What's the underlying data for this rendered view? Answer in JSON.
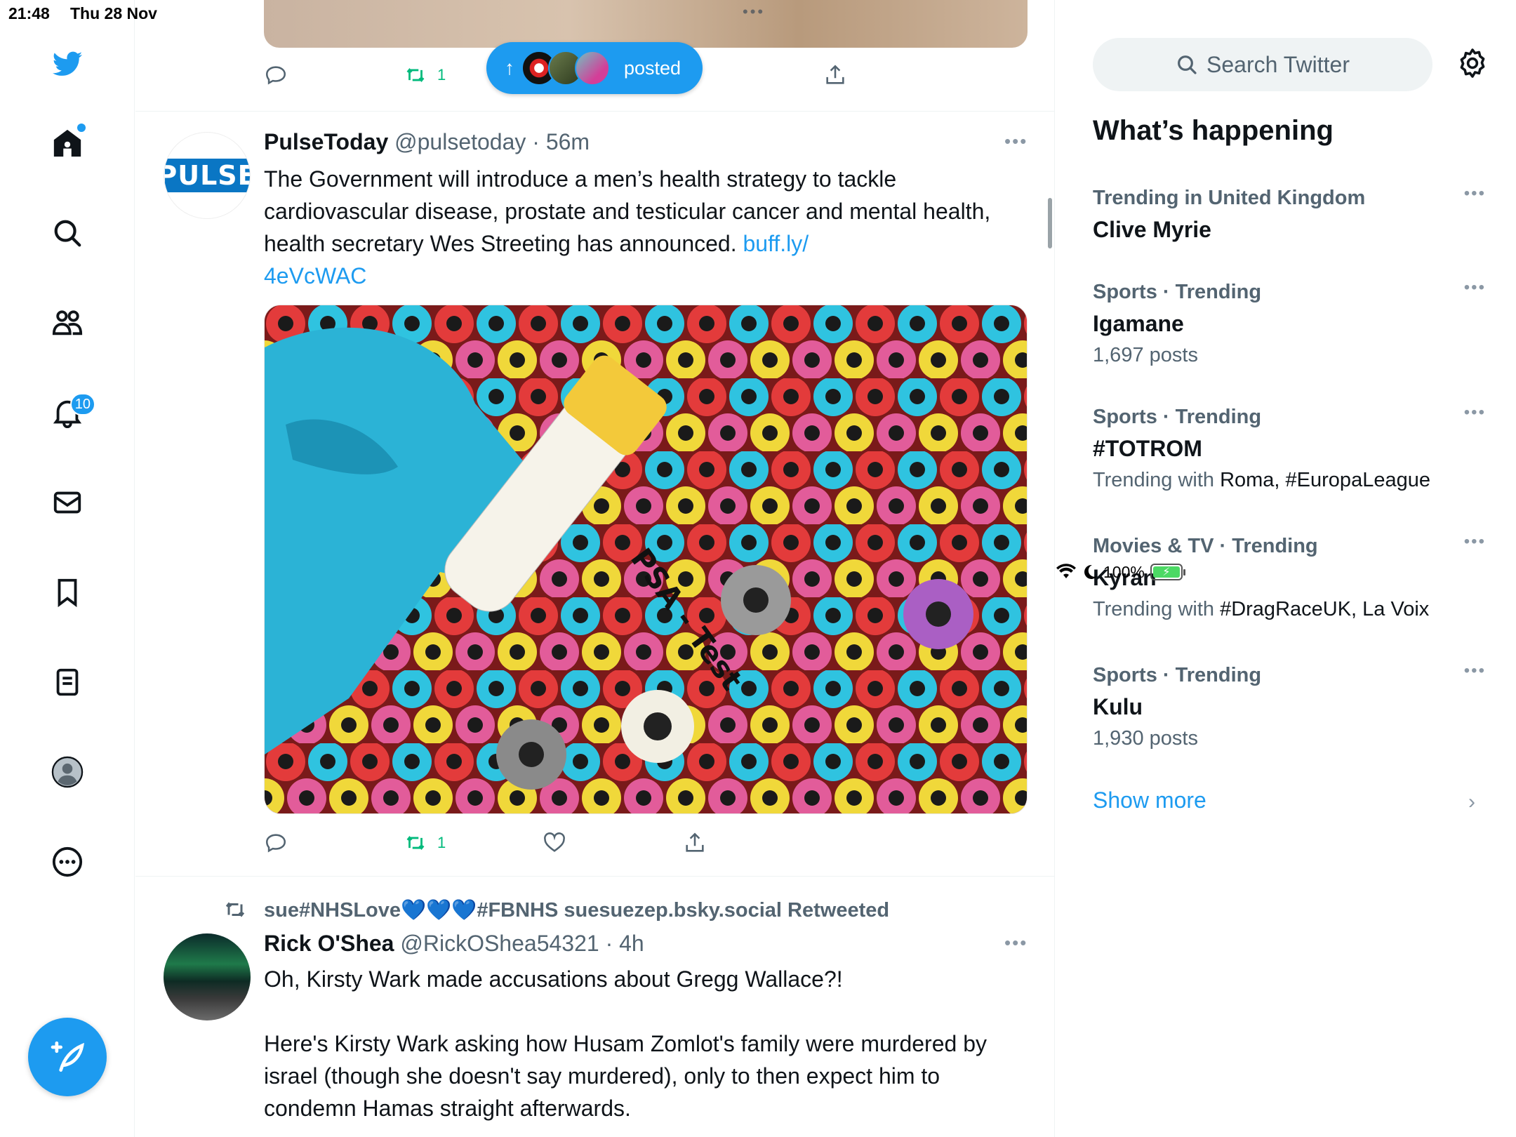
{
  "status_bar": {
    "time": "21:48",
    "date": "Thu 28 Nov",
    "battery": "100%"
  },
  "sidebar": {
    "notifications_badge": "10"
  },
  "feed": {
    "prev_tweet": {
      "retweet_count": "1"
    },
    "new_posts_pill": {
      "label": "posted"
    },
    "tweet1": {
      "name": "PulseToday",
      "handle": "@pulsetoday",
      "time": "56m",
      "avatar_text": "PULSE",
      "text": "The Government will introduce a men’s health strategy to tackle cardiovascular disease, prostate and testicular cancer and mental health, health secretary Wes Streeting has announced. ",
      "link": "buff.ly/\n4eVcWAC",
      "image_label": "PSA - Test",
      "retweet_count": "1"
    },
    "tweet2": {
      "retweeted_by": "sue#NHSLove💙💙💙#FBNHS suesuezep.bsky.social Retweeted",
      "name": "Rick O'Shea",
      "handle": "@RickOShea54321",
      "time": "4h",
      "text_line1": "Oh, Kirsty Wark made accusations about Gregg Wallace?!",
      "text_para2": "Here's Kirsty Wark asking how Husam Zomlot's family were murdered by israel (though she doesn't say murdered), only to then expect him to condemn Hamas straight afterwards."
    }
  },
  "right": {
    "search_placeholder": "Search Twitter",
    "section_title": "What’s happening",
    "trends": [
      {
        "context": "Trending in United Kingdom",
        "title": "Clive Myrie",
        "sub_prefix": "",
        "sub_value": ""
      },
      {
        "context": "Sports · Trending",
        "title": "Igamane",
        "sub_prefix": "1,697 posts",
        "sub_value": ""
      },
      {
        "context": "Sports · Trending",
        "title": "#TOTROM",
        "sub_prefix": "Trending with ",
        "sub_value": "Roma, #EuropaLeague"
      },
      {
        "context": "Movies & TV · Trending",
        "title": "Kyran",
        "sub_prefix": "Trending with ",
        "sub_value": "#DragRaceUK, La Voix"
      },
      {
        "context": "Sports · Trending",
        "title": "Kulu",
        "sub_prefix": "1,930 posts",
        "sub_value": ""
      }
    ],
    "show_more": "Show more"
  },
  "colors": {
    "accent": "#1d9bf0",
    "retweet_green": "#00ba7c",
    "secondary_text": "#536471"
  }
}
